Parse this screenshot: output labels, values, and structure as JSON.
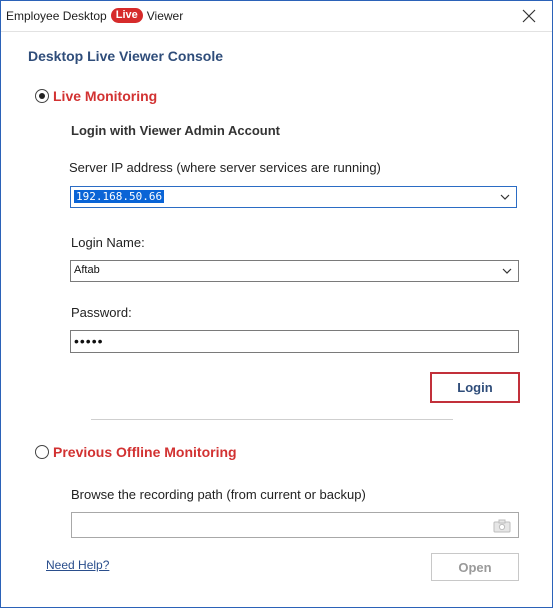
{
  "window": {
    "title_prefix": "Employee Desktop",
    "title_badge": "Live",
    "title_suffix": "Viewer"
  },
  "console_title": "Desktop Live Viewer Console",
  "live_monitoring": {
    "label": "Live Monitoring",
    "selected": true,
    "login_heading": "Login with Viewer Admin Account",
    "server_ip_label": "Server IP address (where server services are running)",
    "server_ip_value": "192.168.50.66",
    "login_name_label": "Login Name:",
    "login_name_value": "Aftab",
    "password_label": "Password:",
    "password_masked": "•••••",
    "login_button": "Login"
  },
  "offline_monitoring": {
    "label": "Previous Offline Monitoring",
    "selected": false,
    "browse_label": "Browse the recording path (from current or backup)",
    "path_value": ""
  },
  "footer": {
    "help_link": "Need Help?",
    "open_button": "Open"
  },
  "colors": {
    "accent_red": "#d23232",
    "title_blue": "#2f4d7a",
    "selection_blue": "#0a64d6"
  }
}
